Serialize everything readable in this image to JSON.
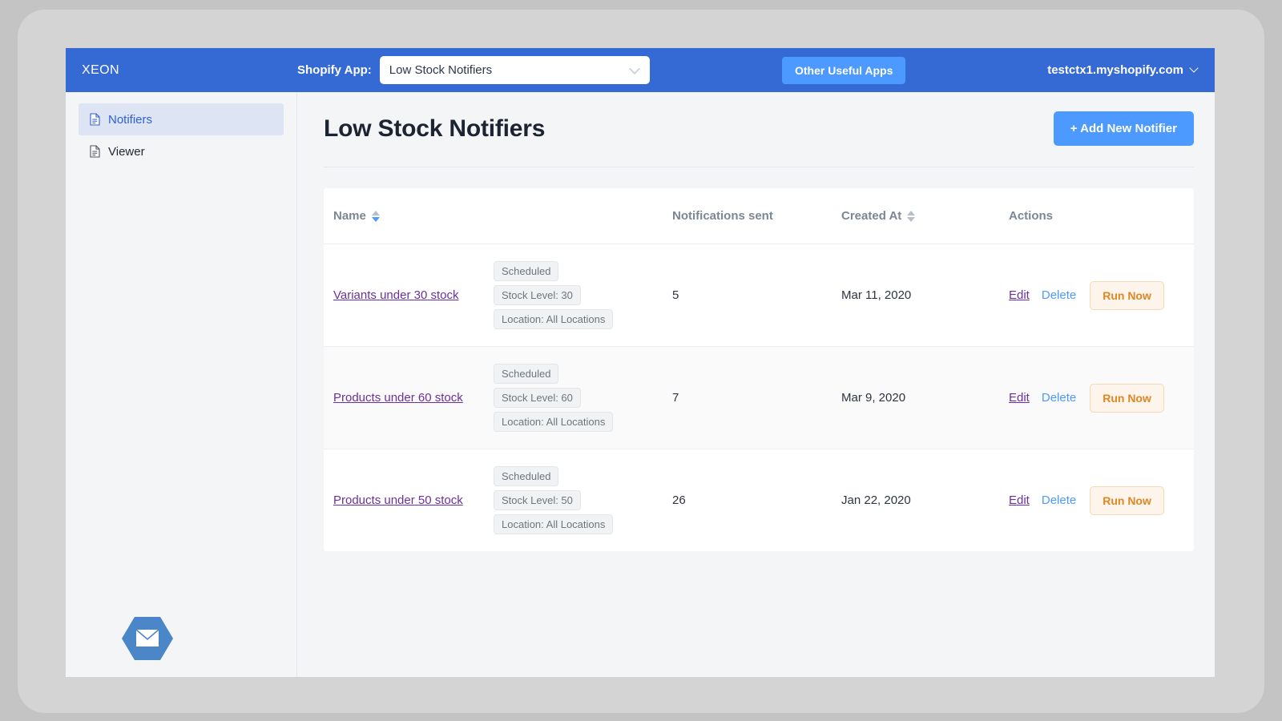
{
  "topbar": {
    "brand": "XEON",
    "app_select_label": "Shopify App:",
    "app_select_value": "Low Stock Notifiers",
    "other_apps_button": "Other Useful Apps",
    "shop_domain": "testctx1.myshopify.com",
    "brand_bg": "#3569d4",
    "accent": "#4c9aff"
  },
  "sidebar": {
    "items": [
      {
        "label": "Notifiers",
        "icon": "document-icon",
        "active": true
      },
      {
        "label": "Viewer",
        "icon": "document-icon",
        "active": false
      }
    ],
    "logo_icon": "envelope-hexagon-icon",
    "logo_color": "#4a86c8"
  },
  "main": {
    "page_title": "Low Stock Notifiers",
    "add_button": "+ Add New Notifier"
  },
  "table": {
    "columns": [
      {
        "key": "name",
        "label": "Name",
        "sortable": true,
        "sort": "desc"
      },
      {
        "key": "sent",
        "label": "Notifications sent",
        "sortable": false,
        "sort": "none"
      },
      {
        "key": "created",
        "label": "Created At",
        "sortable": true,
        "sort": "none"
      },
      {
        "key": "actions",
        "label": "Actions",
        "sortable": false,
        "sort": "none"
      }
    ],
    "rows": [
      {
        "name": "Variants under 30 stock",
        "tags": [
          "Scheduled",
          "Stock Level: 30",
          "Location: All Locations"
        ],
        "sent": "5",
        "created": "Mar 11, 2020",
        "actions": {
          "edit": "Edit",
          "delete": "Delete",
          "run": "Run Now"
        }
      },
      {
        "name": "Products under 60 stock",
        "tags": [
          "Scheduled",
          "Stock Level: 60",
          "Location: All Locations"
        ],
        "sent": "7",
        "created": "Mar 9, 2020",
        "actions": {
          "edit": "Edit",
          "delete": "Delete",
          "run": "Run Now"
        }
      },
      {
        "name": "Products under 50 stock",
        "tags": [
          "Scheduled",
          "Stock Level: 50",
          "Location: All Locations"
        ],
        "sent": "26",
        "created": "Jan 22, 2020",
        "actions": {
          "edit": "Edit",
          "delete": "Delete",
          "run": "Run Now"
        }
      }
    ]
  }
}
